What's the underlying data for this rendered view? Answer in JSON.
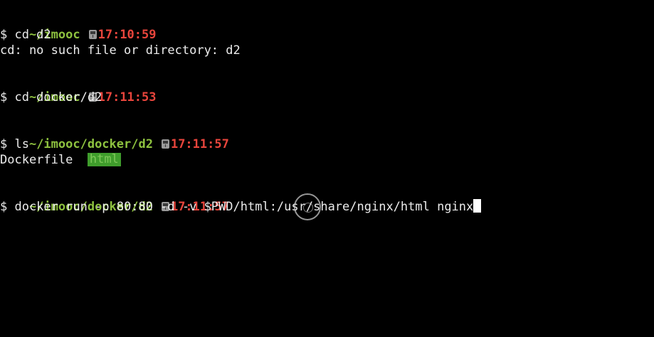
{
  "colors": {
    "background": "#000000",
    "prompt_path": "#8ec23f",
    "prompt_time": "#e8453c",
    "directory_highlight": "#3f9d2c"
  },
  "icons": {
    "clock": "clock-icon"
  },
  "blocks": [
    {
      "path": "~/imooc",
      "time": "17:10:59",
      "command": "$ cd d2",
      "output": "cd: no such file or directory: d2"
    },
    {
      "path": "~/imooc",
      "time": "17:11:53",
      "command": "$ cd docker/d2"
    },
    {
      "path": "~/imooc/docker/d2",
      "time": "17:11:57",
      "command": "$ ls",
      "output_files": [
        "Dockerfile",
        "html"
      ]
    },
    {
      "path": "~/imooc/docker/d2",
      "time": "17:11:57",
      "command": "$ docker run -p 80:80 -d -v $PWD/html:/usr/share/nginx/html nginx"
    }
  ]
}
